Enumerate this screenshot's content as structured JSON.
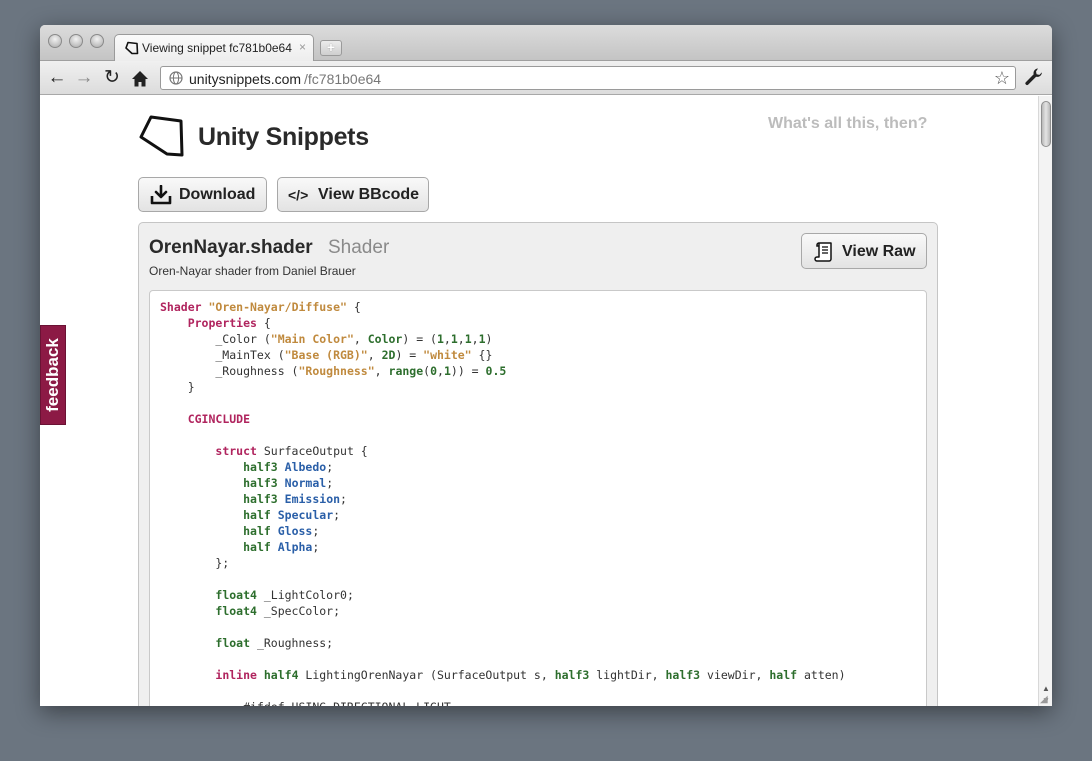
{
  "browser": {
    "tab_title": "Viewing snippet fc781b0e64",
    "tab_close": "×",
    "newtab": "+",
    "url_host": "unitysnippets.com",
    "url_path": "/fc781b0e64",
    "back": "←",
    "forward": "→",
    "reload": "↻",
    "star": "☆"
  },
  "site": {
    "title": "Unity Snippets",
    "about_link": "What's all this, then?"
  },
  "actions": {
    "download": "Download",
    "view_bbcode": "View BBcode",
    "bbcode_icon": "</>"
  },
  "snippet": {
    "name": "OrenNayar.shader",
    "type": "Shader",
    "description": "Oren-Nayar shader from Daniel Brauer",
    "view_raw": "View Raw"
  },
  "code_lines": [
    [
      [
        "kw",
        "Shader"
      ],
      [
        "",
        " "
      ],
      [
        "str",
        "\"Oren-Nayar/Diffuse\""
      ],
      [
        "",
        " {"
      ]
    ],
    [
      [
        "",
        "    "
      ],
      [
        "kw",
        "Properties"
      ],
      [
        "",
        " {"
      ]
    ],
    [
      [
        "",
        "        _Color ("
      ],
      [
        "str",
        "\"Main Color\""
      ],
      [
        "",
        ", "
      ],
      [
        "typ",
        "Color"
      ],
      [
        "",
        ") = ("
      ],
      [
        "num",
        "1"
      ],
      [
        "",
        ","
      ],
      [
        "num",
        "1"
      ],
      [
        "",
        ","
      ],
      [
        "num",
        "1"
      ],
      [
        "",
        ","
      ],
      [
        "num",
        "1"
      ],
      [
        "",
        ")"
      ]
    ],
    [
      [
        "",
        "        _MainTex ("
      ],
      [
        "str",
        "\"Base (RGB)\""
      ],
      [
        "",
        ", "
      ],
      [
        "typ",
        "2D"
      ],
      [
        "",
        ") = "
      ],
      [
        "str",
        "\"white\""
      ],
      [
        "",
        " {}"
      ]
    ],
    [
      [
        "",
        "        _Roughness ("
      ],
      [
        "str",
        "\"Roughness\""
      ],
      [
        "",
        ", "
      ],
      [
        "typ",
        "range"
      ],
      [
        "",
        "("
      ],
      [
        "num",
        "0"
      ],
      [
        "",
        ","
      ],
      [
        "num",
        "1"
      ],
      [
        "",
        ")) = "
      ],
      [
        "num",
        "0.5"
      ]
    ],
    [
      [
        "",
        "    }"
      ]
    ],
    [
      [
        "",
        ""
      ]
    ],
    [
      [
        "",
        "    "
      ],
      [
        "kw",
        "CGINCLUDE"
      ]
    ],
    [
      [
        "",
        ""
      ]
    ],
    [
      [
        "",
        "        "
      ],
      [
        "kw",
        "struct"
      ],
      [
        "",
        " SurfaceOutput {"
      ]
    ],
    [
      [
        "",
        "            "
      ],
      [
        "typ",
        "half3"
      ],
      [
        "",
        " "
      ],
      [
        "fld",
        "Albedo"
      ],
      [
        "",
        ";"
      ]
    ],
    [
      [
        "",
        "            "
      ],
      [
        "typ",
        "half3"
      ],
      [
        "",
        " "
      ],
      [
        "fld",
        "Normal"
      ],
      [
        "",
        ";"
      ]
    ],
    [
      [
        "",
        "            "
      ],
      [
        "typ",
        "half3"
      ],
      [
        "",
        " "
      ],
      [
        "fld",
        "Emission"
      ],
      [
        "",
        ";"
      ]
    ],
    [
      [
        "",
        "            "
      ],
      [
        "typ",
        "half"
      ],
      [
        "",
        " "
      ],
      [
        "fld",
        "Specular"
      ],
      [
        "",
        ";"
      ]
    ],
    [
      [
        "",
        "            "
      ],
      [
        "typ",
        "half"
      ],
      [
        "",
        " "
      ],
      [
        "fld",
        "Gloss"
      ],
      [
        "",
        ";"
      ]
    ],
    [
      [
        "",
        "            "
      ],
      [
        "typ",
        "half"
      ],
      [
        "",
        " "
      ],
      [
        "fld",
        "Alpha"
      ],
      [
        "",
        ";"
      ]
    ],
    [
      [
        "",
        "        };"
      ]
    ],
    [
      [
        "",
        ""
      ]
    ],
    [
      [
        "",
        "        "
      ],
      [
        "typ",
        "float4"
      ],
      [
        "",
        " _LightColor0;"
      ]
    ],
    [
      [
        "",
        "        "
      ],
      [
        "typ",
        "float4"
      ],
      [
        "",
        " _SpecColor;"
      ]
    ],
    [
      [
        "",
        ""
      ]
    ],
    [
      [
        "",
        "        "
      ],
      [
        "typ",
        "float"
      ],
      [
        "",
        " _Roughness;"
      ]
    ],
    [
      [
        "",
        ""
      ]
    ],
    [
      [
        "",
        "        "
      ],
      [
        "kw",
        "inline"
      ],
      [
        "",
        " "
      ],
      [
        "typ",
        "half4"
      ],
      [
        "",
        " LightingOrenNayar (SurfaceOutput s, "
      ],
      [
        "typ",
        "half3"
      ],
      [
        "",
        " lightDir, "
      ],
      [
        "typ",
        "half3"
      ],
      [
        "",
        " viewDir, "
      ],
      [
        "typ",
        "half"
      ],
      [
        "",
        " atten)"
      ]
    ],
    [
      [
        "",
        ""
      ]
    ],
    [
      [
        "",
        "            #ifdef USING_DIRECTIONAL_LIGHT"
      ]
    ]
  ],
  "feedback": "feedback",
  "scroll_up": "▲",
  "scroll_down": "▼",
  "resize_grip": "◢"
}
